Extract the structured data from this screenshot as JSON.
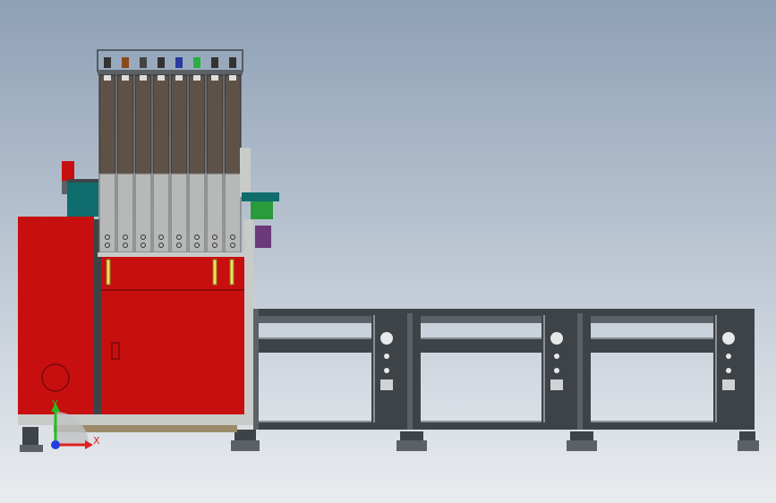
{
  "colors": {
    "bg_top": "#8ea0b6",
    "bg_bottom": "#e9ecef",
    "cabinet_red": "#c80f0f",
    "cabinet_edge": "#7a0a0a",
    "frame_dark": "#3e4347",
    "frame_mid": "#5b6166",
    "frame_light": "#8a9096",
    "slot_upper": "#5e5248",
    "slot_lower": "#b7b8b8",
    "aluminum": "#c9cbc9",
    "teal": "#0f6d6d",
    "axis_x": "#e02020",
    "axis_y": "#20c020",
    "axis_z": "#2040e0"
  },
  "axis_triad": {
    "x_label": "X",
    "y_label": "Y"
  }
}
